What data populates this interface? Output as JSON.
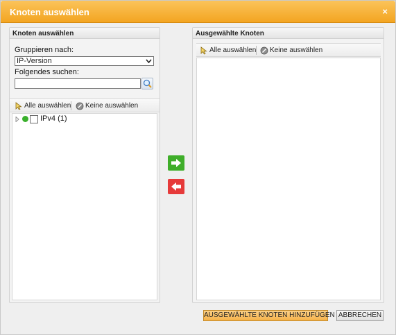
{
  "dialog": {
    "title": "Knoten auswählen",
    "close_label": "×"
  },
  "left_panel": {
    "header": "Knoten auswählen",
    "group_label": "Gruppieren nach:",
    "group_value": "IP-Version",
    "search_label": "Folgendes suchen:",
    "search_value": "",
    "select_all": "Alle auswählen",
    "select_none": "Keine auswählen",
    "tree": [
      {
        "label": "IPv4 (1)",
        "status": "up",
        "checked": false,
        "expanded": false
      }
    ]
  },
  "right_panel": {
    "header": "Ausgewählte Knoten",
    "select_all": "Alle auswählen",
    "select_none": "Keine auswählen"
  },
  "footer": {
    "add_selected": "AUSGEWÄHLTE KNOTEN HINZUFÜGEN",
    "cancel": "ABBRECHEN"
  },
  "colors": {
    "title_bar": "#f3a521",
    "add_arrow": "#3fae2a",
    "remove_arrow": "#e63a3a",
    "status_up": "#3ab02c",
    "primary_button": "#f6b24a"
  },
  "icons": {
    "select_all": "cursor-select-icon",
    "select_none": "clear-circle-icon",
    "search": "magnifier-icon",
    "add": "arrow-right-icon",
    "remove": "arrow-left-icon",
    "expand": "triangle-right-icon",
    "status": "status-dot-icon"
  }
}
